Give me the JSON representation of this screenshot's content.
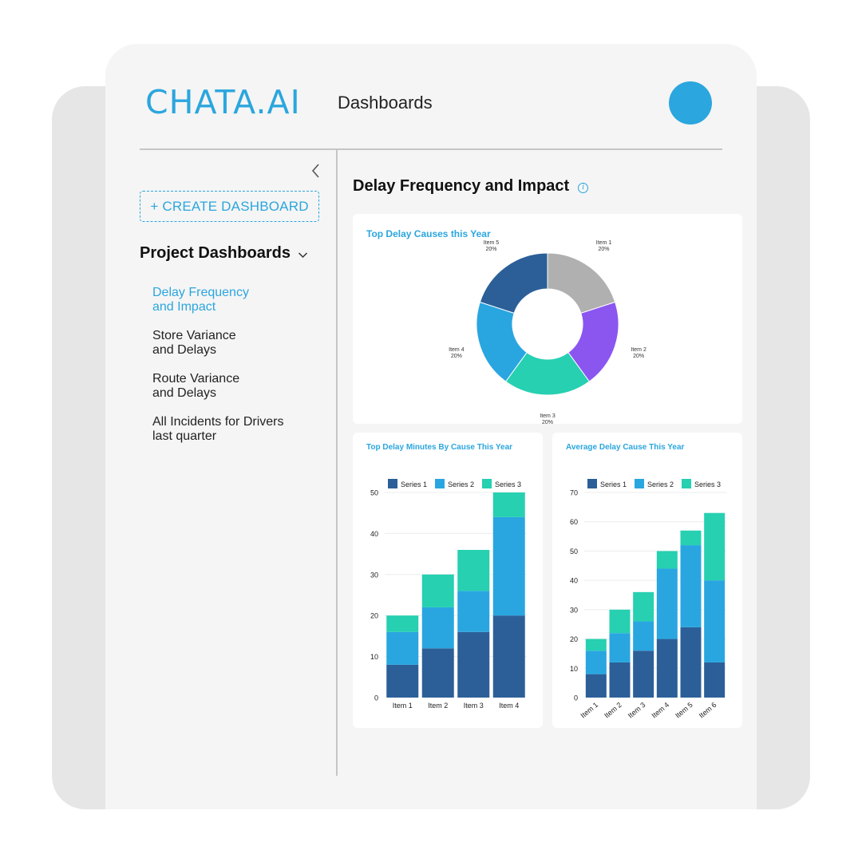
{
  "header": {
    "logo_text": "CHATA.AI",
    "title": "Dashboards",
    "accent_color": "#2ba6de"
  },
  "sidebar": {
    "collapse_icon": "chevron-left-icon",
    "create_button_label": "+ CREATE DASHBOARD",
    "section_heading": "Project Dashboards",
    "section_icon": "chevron-down-icon",
    "items": [
      {
        "line1": "Delay Frequency",
        "line2": "and Impact",
        "active": true
      },
      {
        "line1": "Store Variance",
        "line2": "and Delays",
        "active": false
      },
      {
        "line1": "Route Variance",
        "line2": "and Delays",
        "active": false
      },
      {
        "line1": "All Incidents for Drivers",
        "line2": "last quarter",
        "active": false
      }
    ]
  },
  "main": {
    "title": "Delay Frequency and Impact",
    "info_icon": "info-icon"
  },
  "chart_data": [
    {
      "type": "pie",
      "title": "Top Delay Causes this Year",
      "donut": true,
      "slices": [
        {
          "label": "Item 1",
          "value": 20,
          "percent_label": "20%",
          "color": "#b0b0b0"
        },
        {
          "label": "Item 2",
          "value": 20,
          "percent_label": "20%",
          "color": "#8b55f0"
        },
        {
          "label": "Item 3",
          "value": 20,
          "percent_label": "20%",
          "color": "#26d0b1"
        },
        {
          "label": "Item 4",
          "value": 20,
          "percent_label": "20%",
          "color": "#29a6e0"
        },
        {
          "label": "Item 5",
          "value": 20,
          "percent_label": "20%",
          "color": "#2c5f98"
        }
      ]
    },
    {
      "type": "bar",
      "stacked": true,
      "title": "Top Delay Minutes By Cause This Year",
      "categories": [
        "Item 1",
        "Item 2",
        "Item 3",
        "Item 4"
      ],
      "series": [
        {
          "name": "Series 1",
          "color": "#2c5f98",
          "values": [
            8,
            12,
            16,
            20
          ]
        },
        {
          "name": "Series 2",
          "color": "#29a6e0",
          "values": [
            8,
            10,
            10,
            24
          ]
        },
        {
          "name": "Series 3",
          "color": "#26d0b1",
          "values": [
            4,
            8,
            10,
            6
          ]
        }
      ],
      "ylim": [
        0,
        50
      ],
      "yticks": [
        0,
        10,
        20,
        30,
        40,
        50
      ],
      "legend": "top",
      "grid": true,
      "xlabel_rotation": 0
    },
    {
      "type": "bar",
      "stacked": true,
      "title": "Average Delay Cause This Year",
      "categories": [
        "Item 1",
        "Item 2",
        "Item 3",
        "Item 4",
        "Item 5",
        "Item 6"
      ],
      "series": [
        {
          "name": "Series 1",
          "color": "#2c5f98",
          "values": [
            8,
            12,
            16,
            20,
            24,
            12
          ]
        },
        {
          "name": "Series 2",
          "color": "#29a6e0",
          "values": [
            8,
            10,
            10,
            24,
            28,
            28
          ]
        },
        {
          "name": "Series 3",
          "color": "#26d0b1",
          "values": [
            4,
            8,
            10,
            6,
            5,
            23
          ]
        }
      ],
      "ylim": [
        0,
        70
      ],
      "yticks": [
        0,
        10,
        20,
        30,
        40,
        50,
        60,
        70
      ],
      "legend": "top",
      "grid": true,
      "xlabel_rotation": -40
    }
  ]
}
